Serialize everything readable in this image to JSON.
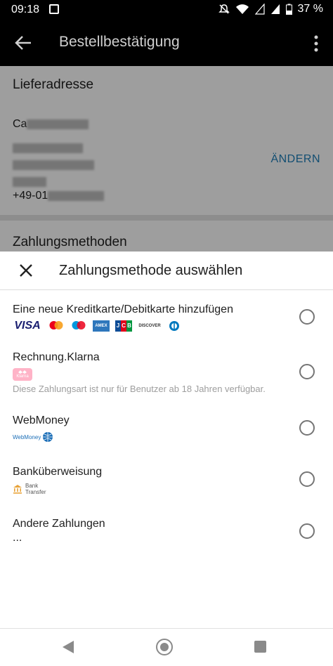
{
  "status": {
    "time": "09:18",
    "battery": "37 %"
  },
  "appbar": {
    "title": "Bestellbestätigung"
  },
  "background": {
    "delivery_title": "Lieferadresse",
    "name_prefix": "Ca",
    "phone_prefix": "+49-01",
    "change_label": "ÄNDERN",
    "payment_title": "Zahlungsmethoden"
  },
  "sheet": {
    "title": "Zahlungsmethode auswählen",
    "options": [
      {
        "label": "Eine neue Kreditkarte/Debitkarte hinzufügen"
      },
      {
        "label": "Rechnung.Klarna",
        "note": "Diese Zahlungsart ist nur für Benutzer ab 18 Jahren verfügbar."
      },
      {
        "label": "WebMoney"
      },
      {
        "label": "Banküberweisung"
      },
      {
        "label": "Andere Zahlungen",
        "sub": "..."
      }
    ],
    "card_logos": {
      "visa": "VISA",
      "amex": "AMEX",
      "jcb": [
        "J",
        "C",
        "B"
      ],
      "discover": "DISCOVER"
    },
    "klarna_logo": "Klarna",
    "webmoney_logo": "WebMoney",
    "bank_logo": [
      "Bank",
      "Transfer"
    ]
  },
  "colors": {
    "accent": "#1e7fb8",
    "appbar": "#000000",
    "radio": "#757575"
  }
}
